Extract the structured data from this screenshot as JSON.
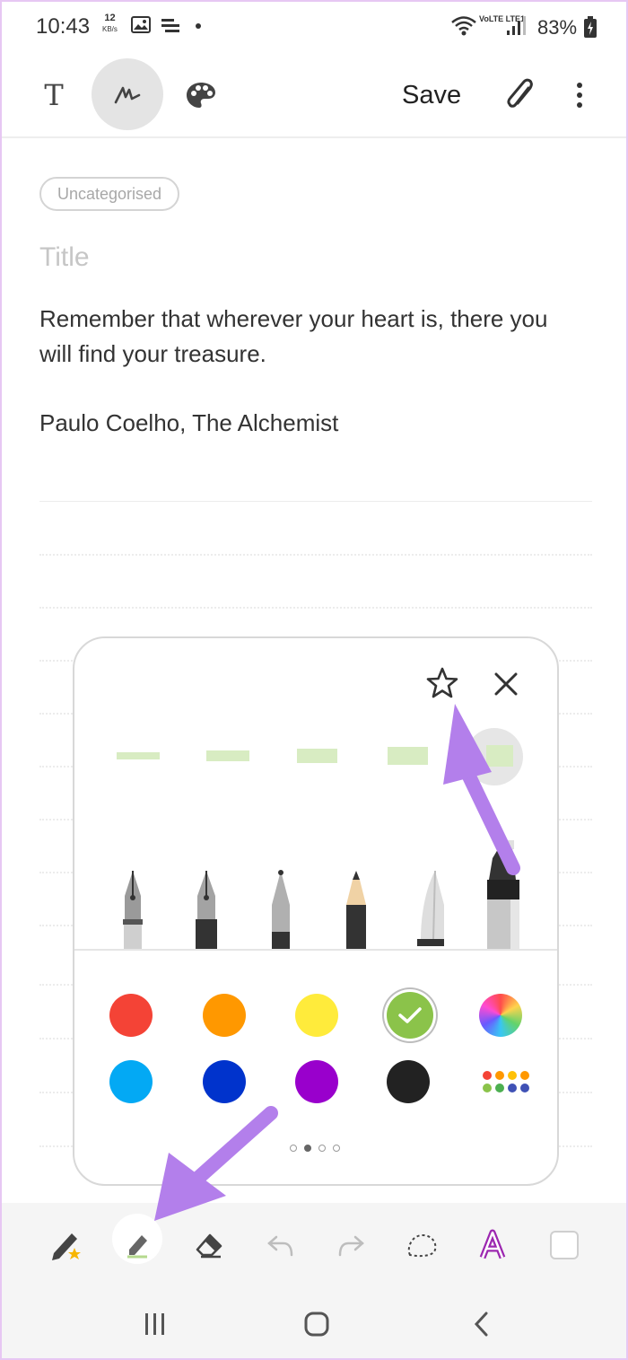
{
  "status_bar": {
    "time": "10:43",
    "net_speed_value": "12",
    "net_speed_unit": "KB/s",
    "signal_label": "VoLTE LTE1",
    "battery": "83%"
  },
  "toolbar": {
    "text_mode_icon": "T",
    "pen_mode_icon": "handwriting-icon",
    "palette_icon": "palette-icon",
    "save_label": "Save",
    "attach_icon": "paperclip-icon",
    "more_icon": "more-vert-icon"
  },
  "note": {
    "category": "Uncategorised",
    "title_placeholder": "Title",
    "body_line1": "Remember that wherever your heart is, there you will find your treasure.",
    "signature": "Paulo Coelho, The Alchemist"
  },
  "pen_panel": {
    "favorite_icon": "star-icon",
    "close_icon": "close-icon",
    "selected_size_index": 4,
    "pens": [
      "fountain-pen",
      "calligraphy-pen",
      "brush-pen",
      "pencil",
      "chisel-pen",
      "marker"
    ],
    "selected_pen": "marker",
    "colors": [
      {
        "name": "red",
        "hex": "#f44336"
      },
      {
        "name": "orange",
        "hex": "#ff9800"
      },
      {
        "name": "yellow",
        "hex": "#ffeb3b"
      },
      {
        "name": "green",
        "hex": "#8bc34a",
        "selected": true
      },
      {
        "name": "spectrum",
        "hex": "rainbow"
      },
      {
        "name": "light-blue",
        "hex": "#03a9f4"
      },
      {
        "name": "blue",
        "hex": "#0033cc"
      },
      {
        "name": "purple",
        "hex": "#9900cc"
      },
      {
        "name": "black",
        "hex": "#222222"
      },
      {
        "name": "more-colors",
        "hex": "palette-grid"
      }
    ],
    "page_count": 4,
    "current_page": 2
  },
  "bottom_bar": {
    "tools": [
      "favorite-pen-icon",
      "highlighter-icon",
      "eraser-icon",
      "undo-icon",
      "redo-icon",
      "lasso-icon",
      "text-style-icon",
      "background-icon"
    ],
    "active_tool": "highlighter-icon"
  },
  "nav_bar": {
    "buttons": [
      "recents-icon",
      "home-icon",
      "back-icon"
    ]
  },
  "accent_color": "#b37feb"
}
